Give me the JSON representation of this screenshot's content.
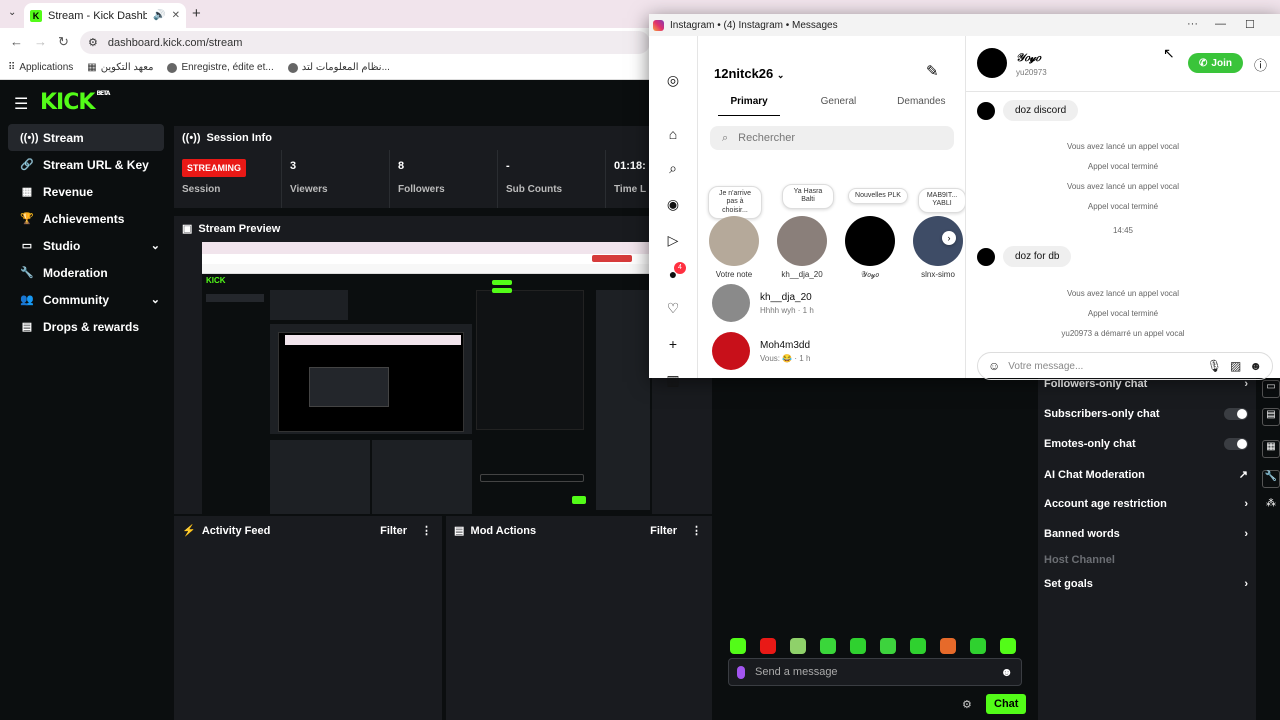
{
  "browser": {
    "tab_title": "Stream - Kick Dashboard",
    "tab_favicon": "K",
    "url": "dashboard.kick.com/stream",
    "bookmarks": [
      "Applications",
      "معهد التكوين",
      "Enregistre, édite et...",
      "نظام المعلومات لتد..."
    ]
  },
  "kick": {
    "logo": "KICK",
    "logo_badge": "BETA",
    "sidebar": [
      {
        "label": "Stream",
        "icon": "((•))"
      },
      {
        "label": "Stream URL & Key",
        "icon": "🔗"
      },
      {
        "label": "Revenue",
        "icon": "▦"
      },
      {
        "label": "Achievements",
        "icon": "🏆"
      },
      {
        "label": "Studio",
        "icon": "▭"
      },
      {
        "label": "Moderation",
        "icon": "🔧"
      },
      {
        "label": "Community",
        "icon": "👥"
      },
      {
        "label": "Drops & rewards",
        "icon": "▤"
      }
    ],
    "session_info": {
      "title": "Session Info",
      "status_badge": "STREAMING",
      "status_label": "Session",
      "viewers": "3",
      "viewers_label": "Viewers",
      "followers": "8",
      "followers_label": "Followers",
      "subs": "-",
      "subs_label": "Sub Counts",
      "time": "01:18:",
      "time_label": "Time L"
    },
    "preview_title": "Stream Preview",
    "activity_feed": {
      "title": "Activity Feed",
      "filter": "Filter"
    },
    "mod_actions": {
      "title": "Mod Actions",
      "filter": "Filter"
    },
    "chat": {
      "placeholder": "Send a message",
      "send": "Chat"
    },
    "chat_actions": {
      "followers_only": "Followers-only chat",
      "subscribers_only": "Subscribers-only chat",
      "emotes_only": "Emotes-only chat",
      "ai_moderation": "AI Chat Moderation",
      "age_restriction": "Account age restriction",
      "banned_words": "Banned words",
      "host_channel": "Host Channel",
      "set_goals": "Set goals"
    },
    "emote_colors": [
      "#53fc18",
      "#e91916",
      "#8fd16a",
      "#3ad63a",
      "#2fd12f",
      "#3dd33d",
      "#2fd12f",
      "#e66a2a",
      "#2fd12f",
      "#53fc18"
    ]
  },
  "instagram": {
    "window_title": "Instagram • (4) Instagram • Messages",
    "account": "12nitck26",
    "notif_count": "4",
    "tabs": [
      "Primary",
      "General",
      "Demandes"
    ],
    "search_placeholder": "Rechercher",
    "note_bubble": "Je n'arrive pas à choisir...",
    "story_notes": [
      "Ya Hasra Balti",
      "Nouvelles PLK",
      "MAB9IT... YABLI"
    ],
    "stories": [
      "Votre note",
      "kh__dja_20",
      "𝒴𝑜𝓎𝑜",
      "slnx-simo"
    ],
    "conversations": [
      {
        "name": "kh__dja_20",
        "preview": "Hhhh wyh · 1 h"
      },
      {
        "name": "Moh4m3dd",
        "preview": "Vous: 😂 · 1 h"
      }
    ],
    "chat": {
      "name": "𝒴𝑜𝓎𝑜",
      "username": "yu20973",
      "join": "Join",
      "msg1": "doz discord",
      "sys1": "Vous avez lancé un appel vocal",
      "sys2": "Appel vocal terminé",
      "sys3": "Vous avez lancé un appel vocal",
      "sys4": "Appel vocal terminé",
      "time": "14:45",
      "msg2": "doz for db",
      "sys5": "Vous avez lancé un appel vocal",
      "sys6": "Appel vocal terminé",
      "sys7": "yu20973 a démarré un appel vocal",
      "placeholder": "Votre message..."
    }
  }
}
